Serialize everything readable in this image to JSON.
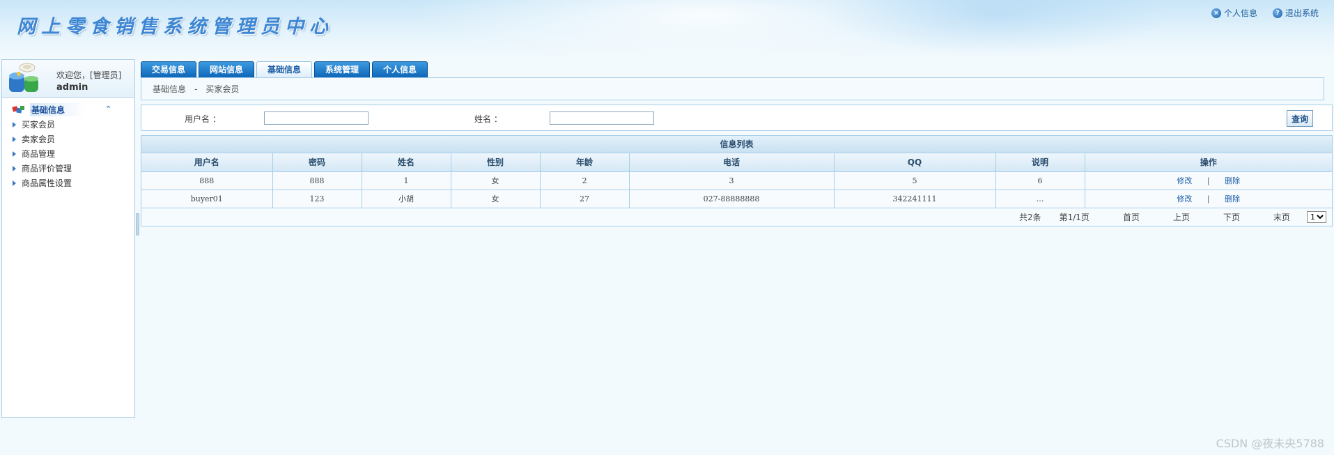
{
  "header": {
    "title": "网上零食销售系统管理员中心",
    "links": [
      {
        "label": "个人信息",
        "icon": "close-circle-icon"
      },
      {
        "label": "退出系统",
        "icon": "help-circle-icon"
      }
    ]
  },
  "sidebar": {
    "welcome": "欢迎您，[管理员]",
    "username": "admin",
    "group_label": "基础信息",
    "items": [
      {
        "label": "买家会员"
      },
      {
        "label": "卖家会员"
      },
      {
        "label": "商品管理"
      },
      {
        "label": "商品评价管理"
      },
      {
        "label": "商品属性设置"
      }
    ]
  },
  "tabs": [
    {
      "label": "交易信息",
      "active": false
    },
    {
      "label": "网站信息",
      "active": false
    },
    {
      "label": "基础信息",
      "active": true
    },
    {
      "label": "系统管理",
      "active": false
    },
    {
      "label": "个人信息",
      "active": false
    }
  ],
  "breadcrumb": {
    "parent": "基础信息",
    "sep": "-",
    "current": "买家会员"
  },
  "search": {
    "username_label": "用户名  ：",
    "username_value": "",
    "name_label": "姓名  ：",
    "name_value": "",
    "query_label": "查询"
  },
  "table": {
    "caption": "信息列表",
    "columns": [
      "用户名",
      "密码",
      "姓名",
      "性别",
      "年龄",
      "电话",
      "QQ",
      "说明",
      "操作"
    ],
    "rows": [
      [
        "888",
        "888",
        "1",
        "女",
        "2",
        "3",
        "5",
        "6"
      ],
      [
        "buyer01",
        "123",
        "小胡",
        "女",
        "27",
        "027-88888888",
        "342241111",
        "..."
      ]
    ],
    "edit_label": "修改",
    "op_sep": "|",
    "delete_label": "删除"
  },
  "pager": {
    "total": "共2条",
    "page_info": "第1/1页",
    "first": "首页",
    "prev": "上页",
    "next": "下页",
    "last": "末页",
    "selected_page": "1"
  },
  "watermark": "CSDN @夜未央5788",
  "colors": {
    "tab_blue": "#0f66b8",
    "border": "#a9cde6",
    "link": "#1d5ea6",
    "title": "#3c86d4"
  }
}
